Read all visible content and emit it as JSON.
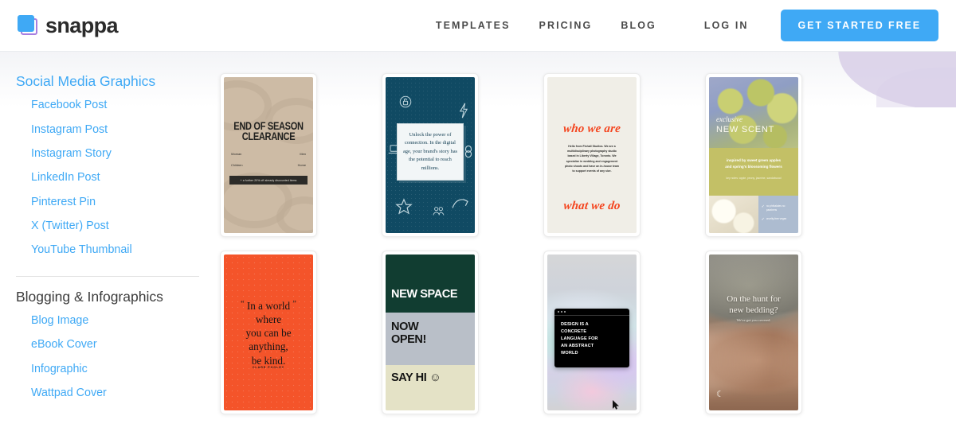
{
  "header": {
    "logo_text": "snappa",
    "nav": [
      {
        "label": "TEMPLATES"
      },
      {
        "label": "PRICING"
      },
      {
        "label": "BLOG"
      },
      {
        "label": "LOG IN"
      }
    ],
    "cta_label": "GET STARTED FREE",
    "accent_color": "#3fa9f5"
  },
  "sidebar": {
    "groups": [
      {
        "heading": "Social Media Graphics",
        "items": [
          {
            "label": "Facebook Post"
          },
          {
            "label": "Instagram Post"
          },
          {
            "label": "Instagram Story"
          },
          {
            "label": "LinkedIn Post"
          },
          {
            "label": "Pinterest Pin"
          },
          {
            "label": "X (Twitter) Post"
          },
          {
            "label": "YouTube Thumbnail"
          }
        ]
      },
      {
        "heading": "Blogging & Infographics",
        "items": [
          {
            "label": "Blog Image"
          },
          {
            "label": "eBook Cover"
          },
          {
            "label": "Infographic"
          },
          {
            "label": "Wattpad Cover"
          }
        ]
      }
    ]
  },
  "templates": {
    "clearance": {
      "title_line1": "END OF SEASON",
      "title_line2": "CLEARANCE",
      "categories": [
        "Woman",
        "Men",
        "Children",
        "Home"
      ],
      "banner": "+ a further 20% off already discounted items",
      "bg_color": "#cdbba5"
    },
    "unlock": {
      "body": "Unlock the power of connection. In the digital age, your brand's story has the potential to reach millions.",
      "bg_color": "#104a63"
    },
    "whoweare": {
      "headline_top": "who we are",
      "headline_bottom": "what we do",
      "body": "Hello from Fishall Studios. We are a multidisciplinary photography studio based in Liberty Village, Toronto. We specialize in wedding and engagement photo shoots and have an in-house team to support events of any size.",
      "bg_color": "#f0eee7"
    },
    "newscent": {
      "eyebrow": "exclusive",
      "title": "NEW SCENT",
      "tagline_line1": "inspired by sweet green apples",
      "tagline_line2": "and spring's blossoming flowers",
      "notes": "key notes:   apple, peony, jasmine, sandalwood",
      "checks": [
        "no phthalates\nno parabens",
        "cruelty-free\nvegan"
      ],
      "band_color": "#c3c066"
    },
    "kindquote": {
      "quote_line1": "In a world",
      "quote_line2": "where",
      "quote_line3": "you can be",
      "quote_line4": "anything,",
      "quote_line5": "be kind.",
      "author": "CLARE POOLEY",
      "bg_color": "#f4542a"
    },
    "newspace": {
      "band1": "NEW SPACE",
      "band2_line1": "NOW",
      "band2_line2": "OPEN!",
      "band3": "SAY HI ☺",
      "band1_color": "#113d31",
      "band2_color": "#b9bfc8",
      "band3_color": "#e4e2c6"
    },
    "designlang": {
      "line1": "DESIGN IS A",
      "line2": "CONCRETE",
      "line3": "LANGUAGE FOR",
      "line4": "AN ABSTRACT",
      "line5": "WORLD"
    },
    "bedding": {
      "headline_line1": "On the hunt for",
      "headline_line2": "new bedding?",
      "subline": "We've got you covered.",
      "moon_icon": "☾"
    }
  }
}
